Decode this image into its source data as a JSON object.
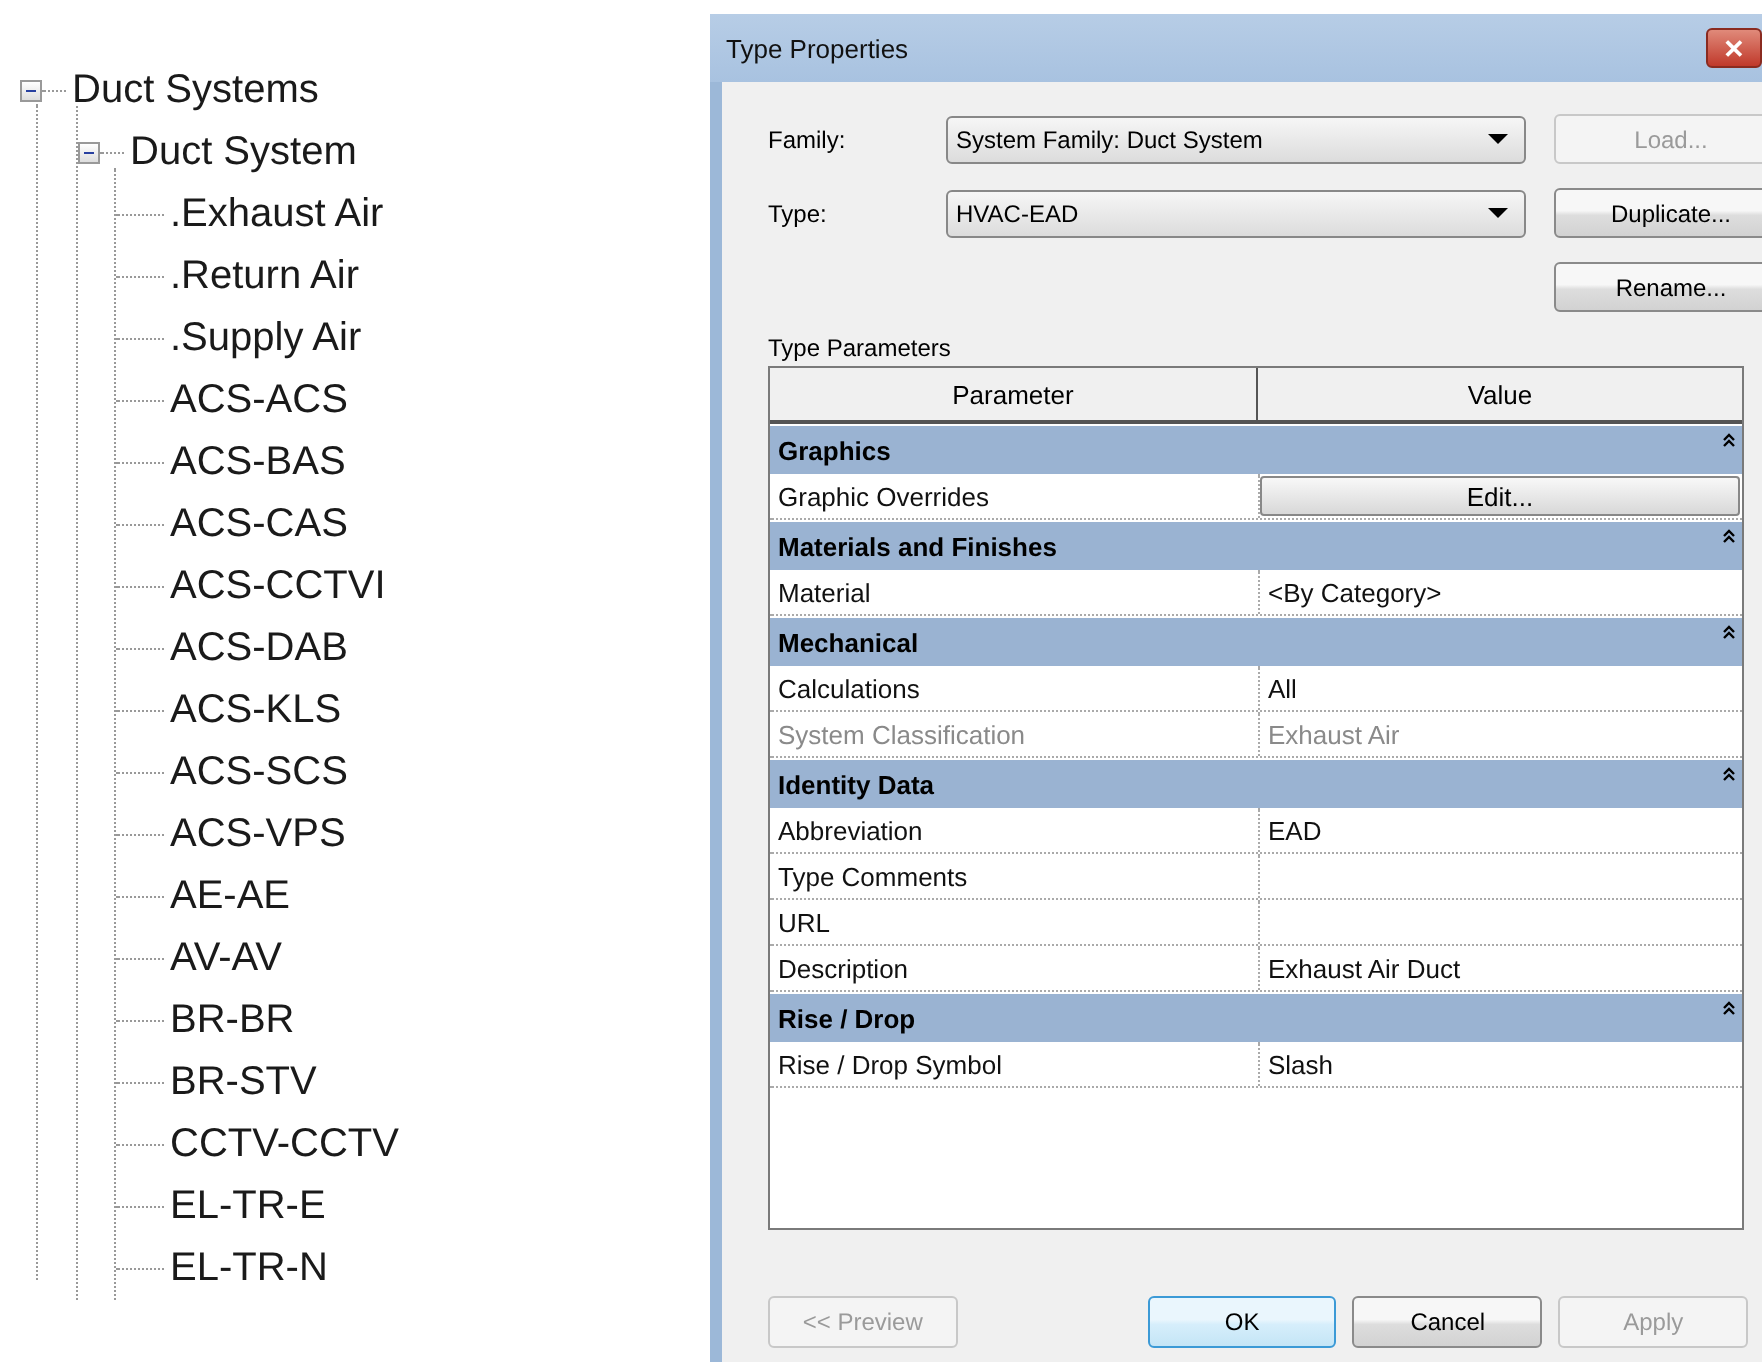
{
  "tree": [
    {
      "label": "Duct Systems",
      "expanded": true,
      "children": [
        {
          "label": "Duct System",
          "expanded": true,
          "children": [
            {
              "label": ".Exhaust Air"
            },
            {
              "label": ".Return Air"
            },
            {
              "label": ".Supply Air"
            },
            {
              "label": "ACS-ACS"
            },
            {
              "label": "ACS-BAS"
            },
            {
              "label": "ACS-CAS"
            },
            {
              "label": "ACS-CCTVI"
            },
            {
              "label": "ACS-DAB"
            },
            {
              "label": "ACS-KLS"
            },
            {
              "label": "ACS-SCS"
            },
            {
              "label": "ACS-VPS"
            },
            {
              "label": "AE-AE"
            },
            {
              "label": "AV-AV"
            },
            {
              "label": "BR-BR"
            },
            {
              "label": "BR-STV"
            },
            {
              "label": "CCTV-CCTV"
            },
            {
              "label": "EL-TR-E"
            },
            {
              "label": "EL-TR-N"
            }
          ]
        }
      ]
    }
  ],
  "window": {
    "title": "Type Properties",
    "close": "✕"
  },
  "fields": [
    {
      "label": "Family:",
      "value": "System Family: Duct System"
    },
    {
      "label": "Type:",
      "value": "HVAC-EAD"
    }
  ],
  "side_buttons": [
    {
      "label": "Load...",
      "disabled": true
    },
    {
      "label": "Duplicate...",
      "disabled": false
    },
    {
      "label": "Rename...",
      "disabled": false
    }
  ],
  "section_label": "Type Parameters",
  "table": {
    "columns": [
      "Parameter",
      "Value"
    ],
    "groups": [
      {
        "name": "Graphics",
        "expanded": true,
        "rows": [
          {
            "kind": "button",
            "parameter": "Graphic Overrides",
            "value": "Edit...",
            "disabled": false
          }
        ]
      },
      {
        "name": "Materials and Finishes",
        "expanded": true,
        "rows": [
          {
            "kind": "text",
            "parameter": "Material",
            "value": "<By Category>",
            "disabled": false
          }
        ]
      },
      {
        "name": "Mechanical",
        "expanded": true,
        "rows": [
          {
            "kind": "text",
            "parameter": "Calculations",
            "value": "All",
            "disabled": false
          },
          {
            "kind": "text",
            "parameter": "System Classification",
            "value": "Exhaust Air",
            "disabled": true
          }
        ]
      },
      {
        "name": "Identity Data",
        "expanded": true,
        "rows": [
          {
            "kind": "text",
            "parameter": "Abbreviation",
            "value": "EAD",
            "disabled": false
          },
          {
            "kind": "text",
            "parameter": "Type Comments",
            "disabled": false
          },
          {
            "kind": "text",
            "parameter": "URL",
            "disabled": false
          },
          {
            "kind": "text",
            "parameter": "Description",
            "value": "Exhaust Air Duct",
            "disabled": false
          }
        ]
      },
      {
        "name": "Rise / Drop",
        "expanded": true,
        "rows": [
          {
            "kind": "text",
            "parameter": "Rise / Drop Symbol",
            "value": "Slash",
            "disabled": false
          }
        ]
      }
    ]
  },
  "bottom_buttons": [
    {
      "label": "<< Preview",
      "disabled": true,
      "default": false
    },
    {
      "label": "OK",
      "disabled": false,
      "default": true
    },
    {
      "label": "Cancel",
      "disabled": false,
      "default": false
    },
    {
      "label": "Apply",
      "disabled": true,
      "default": false
    }
  ]
}
